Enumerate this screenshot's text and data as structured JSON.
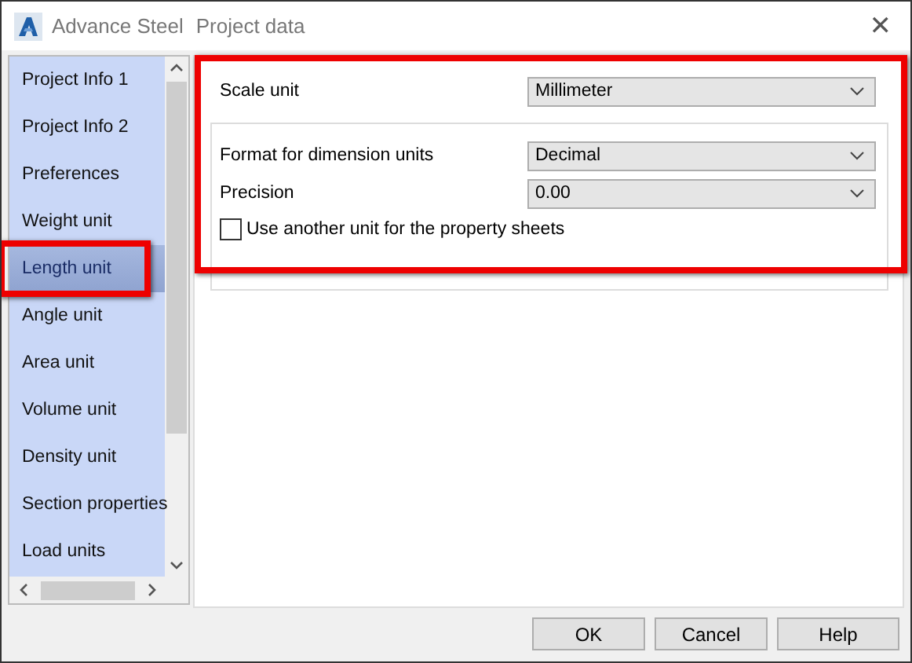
{
  "window": {
    "app": "Advance Steel",
    "title": "Project data",
    "close": "✕"
  },
  "sidebar": {
    "items": [
      {
        "label": "Project Info 1",
        "selected": false,
        "annotated": false
      },
      {
        "label": "Project Info 2",
        "selected": false,
        "annotated": false
      },
      {
        "label": "Preferences",
        "selected": false,
        "annotated": false
      },
      {
        "label": "Weight unit",
        "selected": false,
        "annotated": false
      },
      {
        "label": "Length unit",
        "selected": true,
        "annotated": true
      },
      {
        "label": "Angle unit",
        "selected": false,
        "annotated": false
      },
      {
        "label": "Area unit",
        "selected": false,
        "annotated": false
      },
      {
        "label": "Volume unit",
        "selected": false,
        "annotated": false
      },
      {
        "label": "Density unit",
        "selected": false,
        "annotated": false
      },
      {
        "label": "Section properties",
        "selected": false,
        "annotated": false
      },
      {
        "label": "Load units",
        "selected": false,
        "annotated": false
      }
    ]
  },
  "panel": {
    "annotated": true,
    "scale_unit": {
      "label": "Scale unit",
      "value": "Millimeter"
    },
    "group": {
      "fields": [
        {
          "label": "Format for dimension units",
          "value": "Decimal"
        },
        {
          "label": "Precision",
          "value": "0.00"
        }
      ],
      "checkbox": {
        "label": "Use another unit for the property sheets",
        "checked": false
      }
    }
  },
  "buttons": [
    "OK",
    "Cancel",
    "Help"
  ]
}
